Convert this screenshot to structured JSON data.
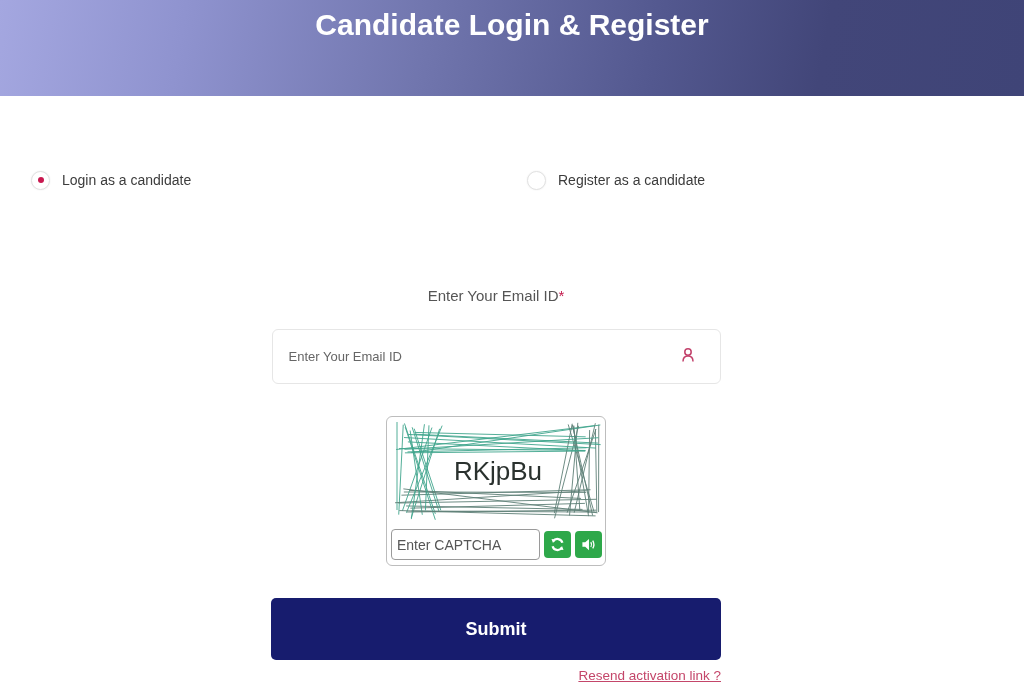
{
  "header": {
    "title": "Candidate Login & Register"
  },
  "mode_options": [
    {
      "label": "Login as a candidate",
      "selected": true
    },
    {
      "label": "Register as a candidate",
      "selected": false
    }
  ],
  "email": {
    "label": "Enter Your Email ID",
    "required_mark": "*",
    "placeholder": "Enter Your Email ID"
  },
  "captcha": {
    "code": "RKjpBu",
    "placeholder": "Enter CAPTCHA"
  },
  "submit_button": "Submit",
  "resend_link": "Resend activation link ?"
}
